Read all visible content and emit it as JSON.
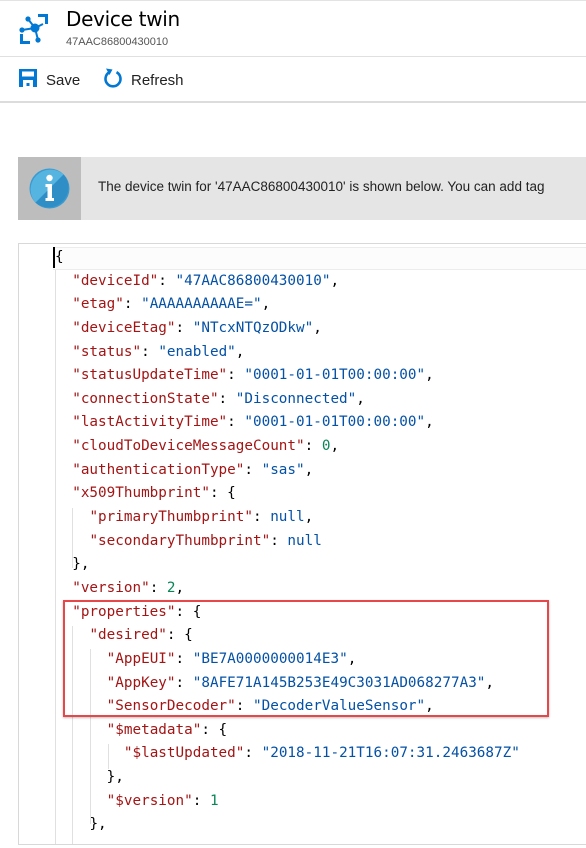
{
  "header": {
    "title": "Device twin",
    "subtitle": "47AAC86800430010",
    "icon": "iot-device-icon"
  },
  "toolbar": {
    "save_label": "Save",
    "refresh_label": "Refresh"
  },
  "info_banner": {
    "icon": "info-icon",
    "text": "The device twin for '47AAC86800430010' is shown below. You can add tag"
  },
  "colors": {
    "accent": "#0078d4",
    "json_key": "#a31515",
    "json_string": "#0451a5",
    "json_number": "#098658",
    "highlight_border": "#e8474a"
  },
  "editor": {
    "lines": [
      {
        "indent": 0,
        "parts": [
          {
            "t": "p",
            "v": "{"
          }
        ]
      },
      {
        "indent": 1,
        "parts": [
          {
            "t": "k",
            "v": "\"deviceId\""
          },
          {
            "t": "p",
            "v": ": "
          },
          {
            "t": "s",
            "v": "\"47AAC86800430010\""
          },
          {
            "t": "p",
            "v": ","
          }
        ]
      },
      {
        "indent": 1,
        "parts": [
          {
            "t": "k",
            "v": "\"etag\""
          },
          {
            "t": "p",
            "v": ": "
          },
          {
            "t": "s",
            "v": "\"AAAAAAAAAAE=\""
          },
          {
            "t": "p",
            "v": ","
          }
        ]
      },
      {
        "indent": 1,
        "parts": [
          {
            "t": "k",
            "v": "\"deviceEtag\""
          },
          {
            "t": "p",
            "v": ": "
          },
          {
            "t": "s",
            "v": "\"NTcxNTQzODkw\""
          },
          {
            "t": "p",
            "v": ","
          }
        ]
      },
      {
        "indent": 1,
        "parts": [
          {
            "t": "k",
            "v": "\"status\""
          },
          {
            "t": "p",
            "v": ": "
          },
          {
            "t": "s",
            "v": "\"enabled\""
          },
          {
            "t": "p",
            "v": ","
          }
        ]
      },
      {
        "indent": 1,
        "parts": [
          {
            "t": "k",
            "v": "\"statusUpdateTime\""
          },
          {
            "t": "p",
            "v": ": "
          },
          {
            "t": "s",
            "v": "\"0001-01-01T00:00:00\""
          },
          {
            "t": "p",
            "v": ","
          }
        ]
      },
      {
        "indent": 1,
        "parts": [
          {
            "t": "k",
            "v": "\"connectionState\""
          },
          {
            "t": "p",
            "v": ": "
          },
          {
            "t": "s",
            "v": "\"Disconnected\""
          },
          {
            "t": "p",
            "v": ","
          }
        ]
      },
      {
        "indent": 1,
        "parts": [
          {
            "t": "k",
            "v": "\"lastActivityTime\""
          },
          {
            "t": "p",
            "v": ": "
          },
          {
            "t": "s",
            "v": "\"0001-01-01T00:00:00\""
          },
          {
            "t": "p",
            "v": ","
          }
        ]
      },
      {
        "indent": 1,
        "parts": [
          {
            "t": "k",
            "v": "\"cloudToDeviceMessageCount\""
          },
          {
            "t": "p",
            "v": ": "
          },
          {
            "t": "n",
            "v": "0"
          },
          {
            "t": "p",
            "v": ","
          }
        ]
      },
      {
        "indent": 1,
        "parts": [
          {
            "t": "k",
            "v": "\"authenticationType\""
          },
          {
            "t": "p",
            "v": ": "
          },
          {
            "t": "s",
            "v": "\"sas\""
          },
          {
            "t": "p",
            "v": ","
          }
        ]
      },
      {
        "indent": 1,
        "parts": [
          {
            "t": "k",
            "v": "\"x509Thumbprint\""
          },
          {
            "t": "p",
            "v": ": {"
          }
        ]
      },
      {
        "indent": 2,
        "parts": [
          {
            "t": "k",
            "v": "\"primaryThumbprint\""
          },
          {
            "t": "p",
            "v": ": "
          },
          {
            "t": "l",
            "v": "null"
          },
          {
            "t": "p",
            "v": ","
          }
        ]
      },
      {
        "indent": 2,
        "parts": [
          {
            "t": "k",
            "v": "\"secondaryThumbprint\""
          },
          {
            "t": "p",
            "v": ": "
          },
          {
            "t": "l",
            "v": "null"
          }
        ]
      },
      {
        "indent": 1,
        "parts": [
          {
            "t": "p",
            "v": "},"
          }
        ]
      },
      {
        "indent": 1,
        "parts": [
          {
            "t": "k",
            "v": "\"version\""
          },
          {
            "t": "p",
            "v": ": "
          },
          {
            "t": "n",
            "v": "2"
          },
          {
            "t": "p",
            "v": ","
          }
        ]
      },
      {
        "indent": 1,
        "parts": [
          {
            "t": "k",
            "v": "\"properties\""
          },
          {
            "t": "p",
            "v": ": {"
          }
        ]
      },
      {
        "indent": 2,
        "parts": [
          {
            "t": "k",
            "v": "\"desired\""
          },
          {
            "t": "p",
            "v": ": {"
          }
        ]
      },
      {
        "indent": 3,
        "parts": [
          {
            "t": "k",
            "v": "\"AppEUI\""
          },
          {
            "t": "p",
            "v": ": "
          },
          {
            "t": "s",
            "v": "\"BE7A0000000014E3\""
          },
          {
            "t": "p",
            "v": ","
          }
        ]
      },
      {
        "indent": 3,
        "parts": [
          {
            "t": "k",
            "v": "\"AppKey\""
          },
          {
            "t": "p",
            "v": ": "
          },
          {
            "t": "s",
            "v": "\"8AFE71A145B253E49C3031AD068277A3\""
          },
          {
            "t": "p",
            "v": ","
          }
        ]
      },
      {
        "indent": 3,
        "parts": [
          {
            "t": "k",
            "v": "\"SensorDecoder\""
          },
          {
            "t": "p",
            "v": ": "
          },
          {
            "t": "s",
            "v": "\"DecoderValueSensor\""
          },
          {
            "t": "p",
            "v": ","
          }
        ]
      },
      {
        "indent": 3,
        "parts": [
          {
            "t": "k",
            "v": "\"$metadata\""
          },
          {
            "t": "p",
            "v": ": {"
          }
        ]
      },
      {
        "indent": 4,
        "parts": [
          {
            "t": "k",
            "v": "\"$lastUpdated\""
          },
          {
            "t": "p",
            "v": ": "
          },
          {
            "t": "s",
            "v": "\"2018-11-21T16:07:31.2463687Z\""
          }
        ]
      },
      {
        "indent": 3,
        "parts": [
          {
            "t": "p",
            "v": "},"
          }
        ]
      },
      {
        "indent": 3,
        "parts": [
          {
            "t": "k",
            "v": "\"$version\""
          },
          {
            "t": "p",
            "v": ": "
          },
          {
            "t": "n",
            "v": "1"
          }
        ]
      },
      {
        "indent": 2,
        "parts": [
          {
            "t": "p",
            "v": "},"
          }
        ]
      }
    ]
  }
}
